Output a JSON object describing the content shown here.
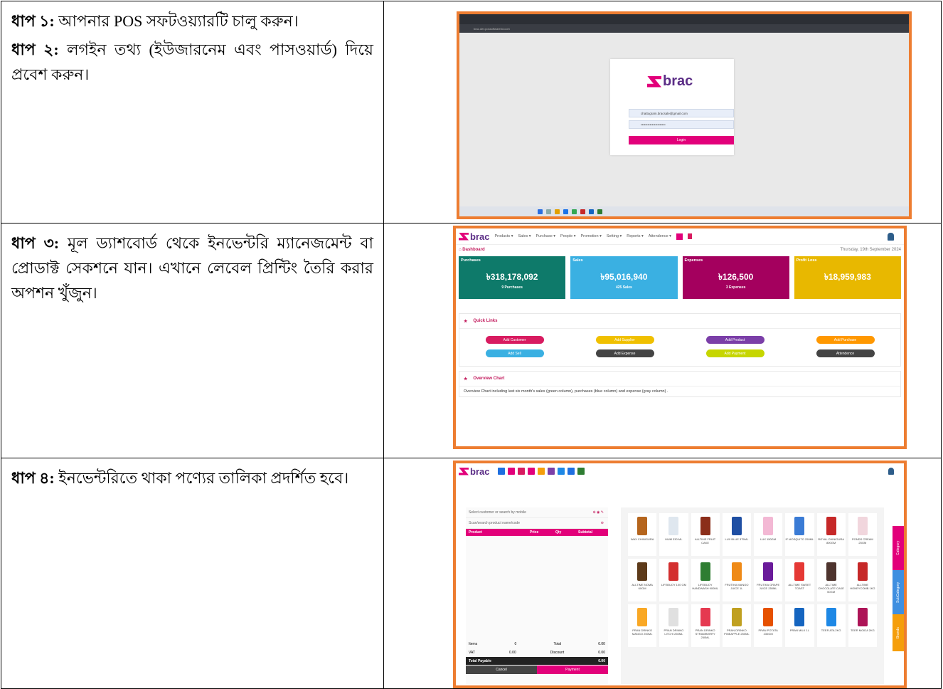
{
  "rows": [
    {
      "step_label": "ধাপ ১:",
      "text": "আপনার POS সফটওয়্যারটি চালু করুন।",
      "step2_label": "ধাপ ২:",
      "text2": "লগইন তথ্য (ইউজারনেম এবং পাসওয়ার্ড) দিয়ে প্রবেশ করুন।"
    },
    {
      "step_label": "ধাপ ৩:",
      "text": "মূল ড্যাশবোর্ড থেকে ইনভেন্টরি ম্যানেজমেন্ট বা প্রোডাক্ট সেকশনে যান। এখানে লেবেল প্রিন্টিং তৈরি করার অপশন খুঁজুন।"
    },
    {
      "step_label": "ধাপ ৪:",
      "text": "ইনভেন্টরিতে থাকা পণ্যের তালিকা প্রদর্শিত হবে।"
    }
  ],
  "login": {
    "logo": "brac",
    "address": "brac.dev.possoftwarebd.com",
    "email": "chattogram.bracsale@gmail.com",
    "password": "••••••••••••••••••••••",
    "button": "Login"
  },
  "dashboard": {
    "logo": "brac",
    "menu": [
      "Products ▾",
      "Sales ▾",
      "Purchase ▾",
      "People ▾",
      "Promotion ▾",
      "Setting ▾",
      "Reports ▾",
      "Attendence ▾"
    ],
    "crumb": "Dashboard",
    "date": "Thursday, 19th September 2024",
    "tiles": [
      {
        "label": "Purchases",
        "value": "৳318,178,092",
        "sub": "9 Purchases",
        "color": "#0e7a6a"
      },
      {
        "label": "Sales",
        "value": "৳95,016,940",
        "sub": "425 Sales",
        "color": "#3ab0e2"
      },
      {
        "label": "Expenses",
        "value": "৳126,500",
        "sub": "3 Expenses",
        "color": "#a4005e"
      },
      {
        "label": "Profit Loss",
        "value": "৳18,959,983",
        "sub": "",
        "color": "#e8b800"
      }
    ],
    "quick_title": "Quick Links",
    "quick_links": [
      {
        "label": "Add Customer",
        "color": "#d81b60"
      },
      {
        "label": "Add Supplier",
        "color": "#f0c000"
      },
      {
        "label": "Add Product",
        "color": "#7b3fa8"
      },
      {
        "label": "Add Purchase",
        "color": "#ff9800"
      },
      {
        "label": "Add Sell",
        "color": "#3ab0e2"
      },
      {
        "label": "Add Expense",
        "color": "#444444"
      },
      {
        "label": "Add Payment",
        "color": "#c6d600"
      },
      {
        "label": "Attendence",
        "color": "#444444"
      }
    ],
    "chart_title": "Overview Chart",
    "chart_note": "Overview Chart including last six month's sales (green column), purchases (blue column) and expense (gray column) ."
  },
  "pos": {
    "logo": "brac",
    "customer_placeholder": "Select customer or search by mobile",
    "product_placeholder": "Scan/search product name/code",
    "cols": [
      "Product",
      "Price",
      "Qty",
      "Subtotal"
    ],
    "items_label": "Items",
    "items_val": "0",
    "total_label": "Total",
    "total_val": "0.00",
    "vat_label": "VAT",
    "vat_val": "0.00",
    "discount_label": "Discount",
    "discount_val": "0.00",
    "payable_label": "Total Payable",
    "payable_val": "0.00",
    "cancel": "Cancel",
    "payment": "Payment",
    "products": [
      {
        "name": "WAX CHINIGURA",
        "c": "#b5651d"
      },
      {
        "name": "MUM 330 ML",
        "c": "#dfe7ef"
      },
      {
        "name": "ALLTIME FRUIT CAKE",
        "c": "#8b2e1a"
      },
      {
        "name": "LUX BLUE 375ML",
        "c": "#1f4fa3"
      },
      {
        "name": "LUX 150GM",
        "c": "#f3b8d4"
      },
      {
        "name": "IF MOSQUITO 250ML",
        "c": "#3a7bd5"
      },
      {
        "name": "ROYAL CHINIGURA 800GM",
        "c": "#c62828"
      },
      {
        "name": "PONDS CREAM 25GM",
        "c": "#f1d6dd"
      },
      {
        "name": "ALLTIME NOMA 60GM",
        "c": "#5d3a1a"
      },
      {
        "name": "LIFEBUOY 100 GM",
        "c": "#d32f2f"
      },
      {
        "name": "LIFEBUOY HANDWASH 900ML",
        "c": "#2e7d32"
      },
      {
        "name": "FRUTIKA MANGO JUICE 1L",
        "c": "#ef8a17"
      },
      {
        "name": "FRUTIKA GRAPE JUICE 250ML",
        "c": "#6a1b9a"
      },
      {
        "name": "ALLTIME SWEET TOAST",
        "c": "#e53935"
      },
      {
        "name": "ALLTIME CHOCOLATE CAKE 50GM",
        "c": "#4e342e"
      },
      {
        "name": "ALLTIME HONEYCOMB 1KG",
        "c": "#c62828"
      },
      {
        "name": "PRAN DRINKO MANGO 250ML",
        "c": "#f9a825"
      },
      {
        "name": "PRAN DRINKO LITCHI 250ML",
        "c": "#e0e0e0"
      },
      {
        "name": "PRAN DRINKO STRAWBERRY 250ML",
        "c": "#e53950"
      },
      {
        "name": "PRAN DRINKO PINEAPPLE 250ML",
        "c": "#c0a020"
      },
      {
        "name": "PRAN POTATA 230GM",
        "c": "#e65100"
      },
      {
        "name": "PRAN MILK 1L",
        "c": "#1565c0"
      },
      {
        "name": "TEER ATA 2KG",
        "c": "#1e88e5"
      },
      {
        "name": "TEER MOIDA 2KG",
        "c": "#ad1457"
      }
    ],
    "side_tabs": [
      {
        "label": "Category",
        "color": "#e2007a"
      },
      {
        "label": "SubCategory",
        "color": "#3f8fe0"
      },
      {
        "label": "Brands",
        "color": "#f59e0b"
      }
    ],
    "toolbar_colors": [
      "#1e6fe0",
      "#e2007a",
      "#d81b60",
      "#e2007a",
      "#f59e0b",
      "#7b3fa8",
      "#1e88e5",
      "#1e6fe0",
      "#2e7d32"
    ]
  }
}
